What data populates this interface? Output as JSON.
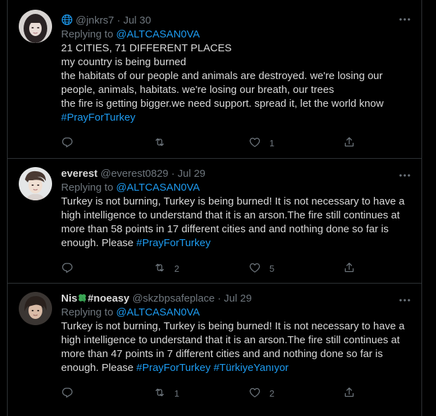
{
  "colors": {
    "background": "#000000",
    "text": "#d9d9d9",
    "muted": "#6e767d",
    "accent": "#1d9bf0",
    "divider": "#2f3336"
  },
  "icons": {
    "globe": "globe-icon",
    "more": "more-options-icon",
    "reply": "reply-icon",
    "retweet": "retweet-icon",
    "like": "like-icon",
    "share": "share-icon",
    "clover": "four-leaf-clover-icon"
  },
  "tweets": [
    {
      "display_name": "",
      "handle": "@jnkrs7",
      "separator": "·",
      "date": "Jul 30",
      "replying_prefix": "Replying to",
      "replying_to": "@ALTCASAN0VA",
      "lines": [
        "21 CITIES, 71 DIFFERENT PLACES",
        "my country is being burned",
        "the habitats of our people and animals are destroyed. we're losing our",
        "people, animals, habitats. we're losing our breath, our trees",
        "the fire is getting bigger.we need support. spread it, let the world know"
      ],
      "hashtag_line": "#PrayForTurkey",
      "replies": "",
      "retweets": "",
      "likes": "1"
    },
    {
      "display_name": "everest",
      "handle": "@everest0829",
      "separator": "·",
      "date": "Jul 29",
      "replying_prefix": "Replying to",
      "replying_to": "@ALTCASAN0VA",
      "lines": [
        "Turkey is not burning, Turkey is being burned! It is not necessary to have a",
        "high intelligence to understand that it is an arson.The fire still continues at",
        "more than 58 points in 17 different cities and and nothing done so far is"
      ],
      "last_line_text": "enough. Please ",
      "last_line_hashtags": [
        "#PrayForTurkey"
      ],
      "replies": "",
      "retweets": "2",
      "likes": "5"
    },
    {
      "display_name_prefix": "Nis",
      "display_name_suffix": "#noeasy",
      "handle": "@skzbpsafeplace",
      "separator": "·",
      "date": "Jul 29",
      "replying_prefix": "Replying to",
      "replying_to": "@ALTCASAN0VA",
      "lines": [
        "Turkey is not burning, Turkey is being burned! It is not necessary to have a",
        "high intelligence to understand that it is an arson.The fire still continues at",
        "more than 47 points in 7 different cities and and nothing done so far is"
      ],
      "last_line_text": "enough. Please ",
      "last_line_hashtags": [
        "#PrayForTurkey",
        "#TürkiyeYanıyor"
      ],
      "replies": "",
      "retweets": "1",
      "likes": "2"
    }
  ]
}
